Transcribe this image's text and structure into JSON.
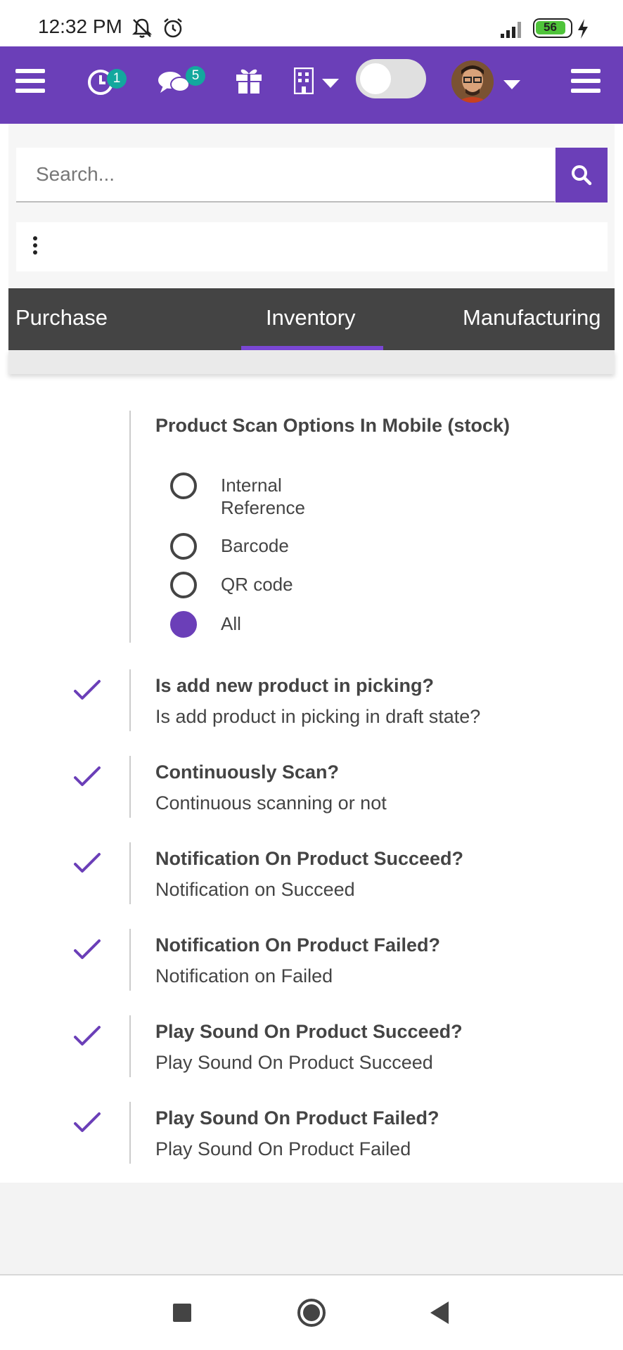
{
  "status_bar": {
    "time": "12:32 PM",
    "battery": "56",
    "icons": [
      "mute-icon",
      "alarm-icon",
      "signal-icon",
      "battery-icon",
      "charging-icon"
    ]
  },
  "header": {
    "color": "#6b3fb8",
    "activity_badge": "1",
    "messages_badge": "5",
    "icons": [
      "menu-icon",
      "clock-icon",
      "chat-icon",
      "gift-icon",
      "building-icon",
      "toggle",
      "avatar",
      "menu-icon"
    ]
  },
  "search": {
    "placeholder": "Search..."
  },
  "tabs": [
    {
      "label": "Purchase"
    },
    {
      "label": "Inventory"
    },
    {
      "label": "Manufacturing"
    }
  ],
  "active_tab": "Inventory",
  "scan_options": {
    "title": "Product Scan Options In Mobile (stock)",
    "options": [
      {
        "label": "Internal Reference",
        "checked": false
      },
      {
        "label": "Barcode",
        "checked": false
      },
      {
        "label": "QR code",
        "checked": false
      },
      {
        "label": "All",
        "checked": true
      }
    ]
  },
  "settings": [
    {
      "title": "Is add new product in picking?",
      "desc": "Is add product in picking in draft state?",
      "checked": true
    },
    {
      "title": "Continuously Scan?",
      "desc": "Continuous scanning or not",
      "checked": true
    },
    {
      "title": "Notification On Product Succeed?",
      "desc": "Notification on Succeed",
      "checked": true
    },
    {
      "title": "Notification On Product Failed?",
      "desc": "Notification on Failed",
      "checked": true
    },
    {
      "title": "Play Sound On Product Succeed?",
      "desc": "Play Sound On Product Succeed",
      "checked": true
    },
    {
      "title": "Play Sound On Product Failed?",
      "desc": "Play Sound On Product Failed",
      "checked": true
    }
  ],
  "accent_color": "#6b3fb8"
}
